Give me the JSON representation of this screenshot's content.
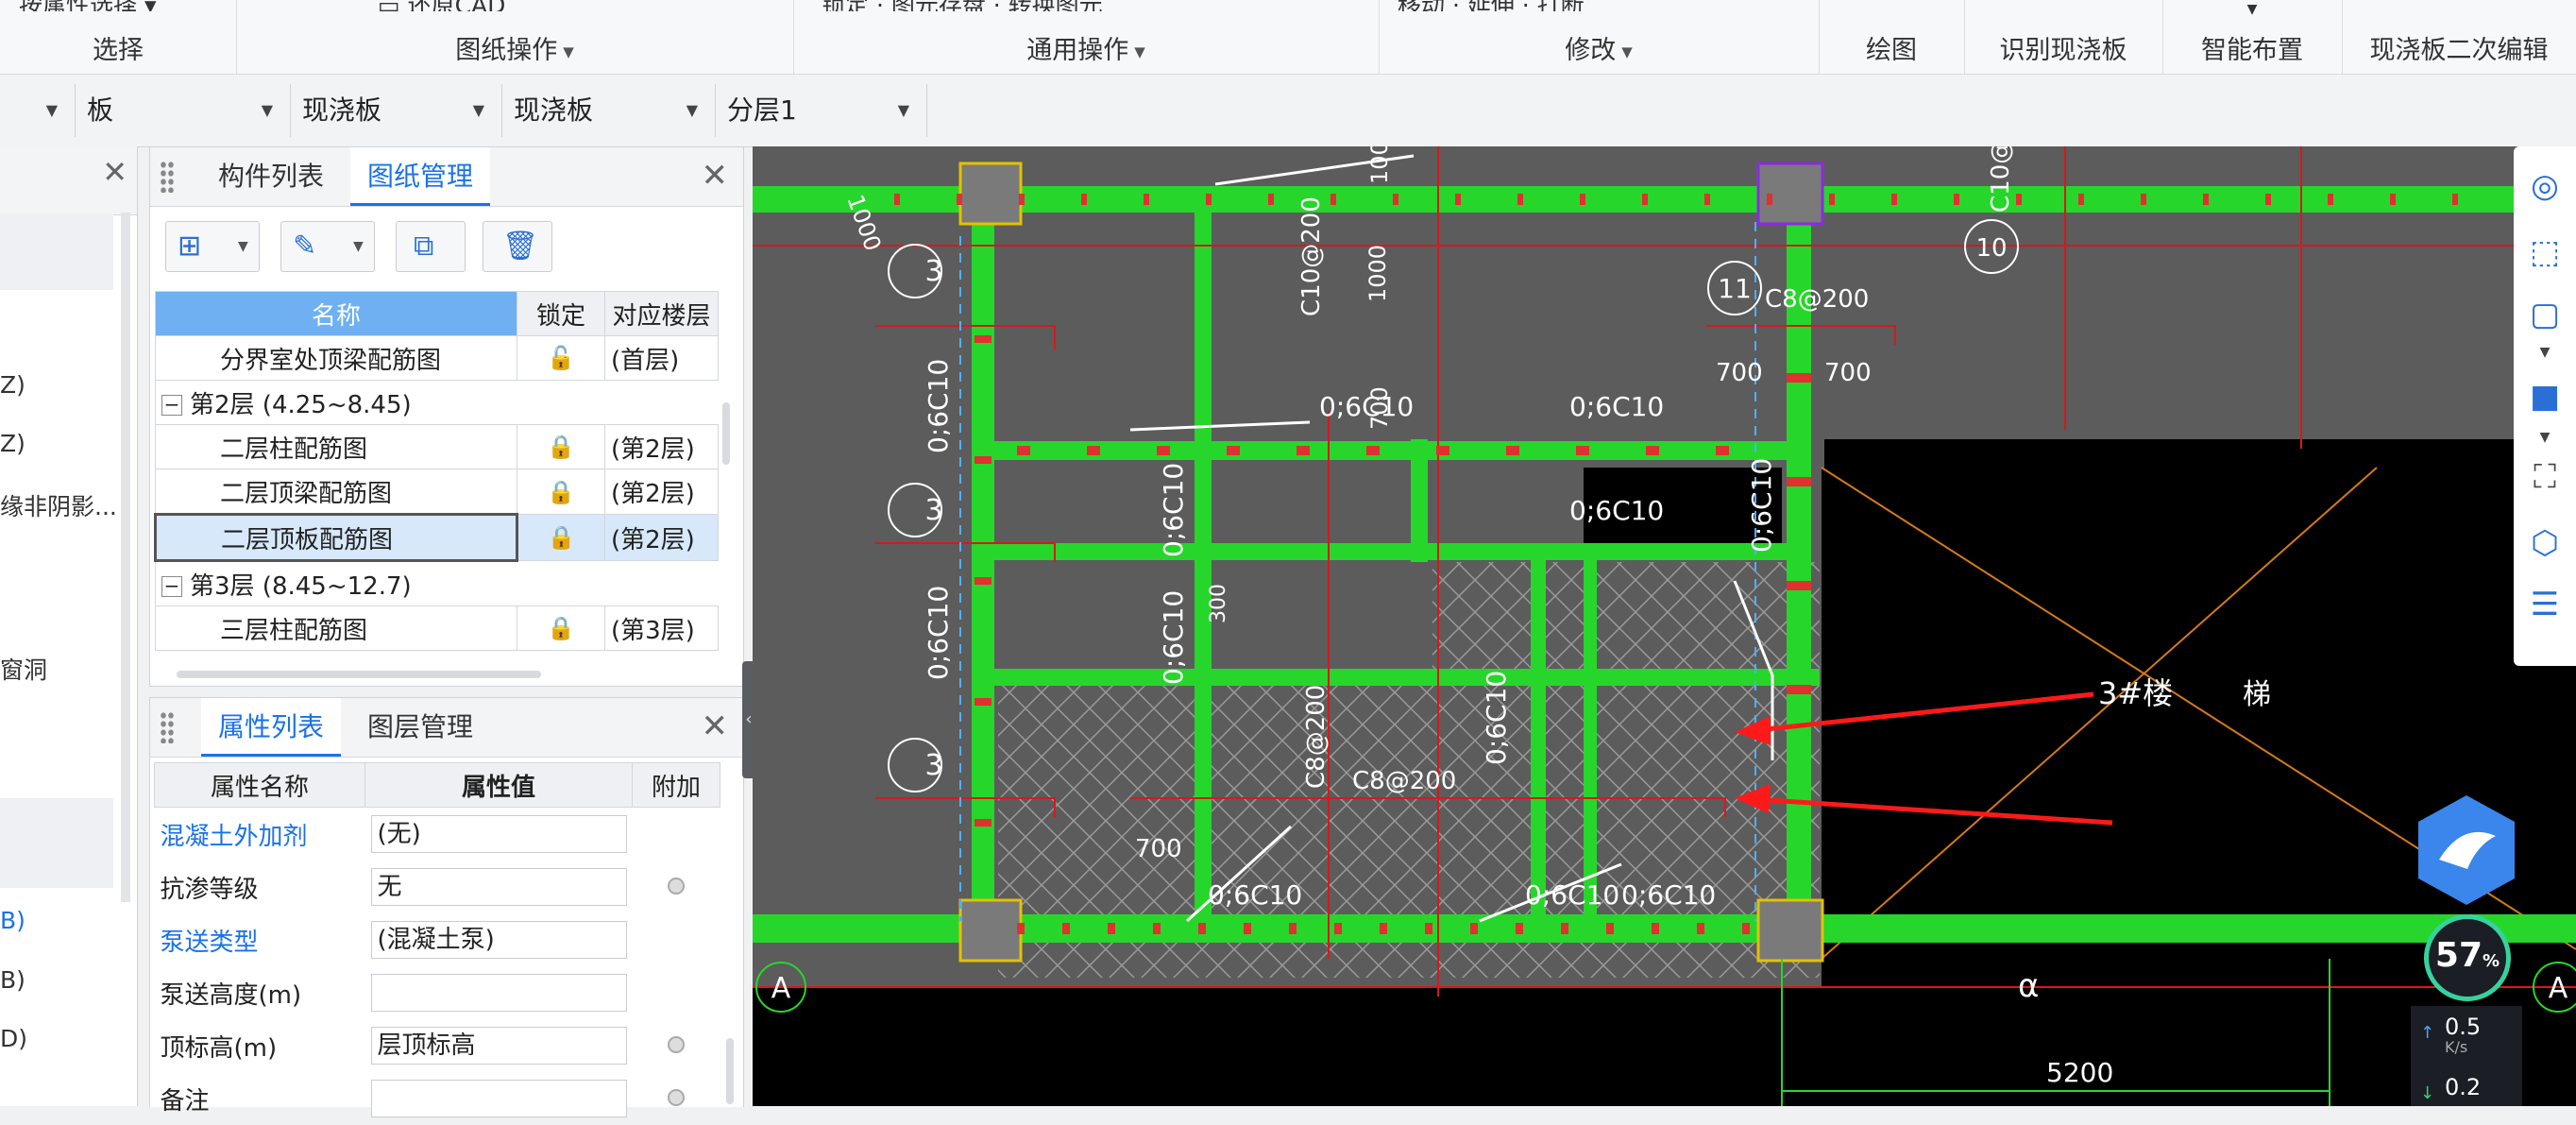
{
  "ribbon": {
    "groups": [
      {
        "top": "按属性选择",
        "label": "选择"
      },
      {
        "top": "还原CAD",
        "label": "图纸操作"
      },
      {
        "top": "锁定 · 图元存盘 · 转换图元",
        "label": "通用操作"
      },
      {
        "top": "移动 · 延伸 · 打断",
        "label": "修改"
      },
      {
        "top": "",
        "label": "绘图"
      },
      {
        "top": "",
        "label": "识别现浇板"
      },
      {
        "top": "",
        "label": "智能布置"
      },
      {
        "top": "",
        "label": "现浇板二次编辑"
      }
    ]
  },
  "selector": {
    "items": [
      "",
      "板",
      "现浇板",
      "现浇板",
      "分层1"
    ]
  },
  "left_panel": {
    "items": [
      "Z)",
      "Z)",
      "缘非阴影...",
      "窗洞",
      "B)",
      "B)",
      "D)"
    ]
  },
  "drawing_panel": {
    "tabs": [
      "构件列表",
      "图纸管理"
    ],
    "columns": [
      "名称",
      "锁定",
      "对应楼层"
    ],
    "rows": [
      {
        "name": "分界室处顶梁配筋图",
        "lock": "🔓",
        "floor": "(首层)",
        "group": false
      },
      {
        "name": "第2层 (4.25~8.45)",
        "lock": "",
        "floor": "",
        "group": true
      },
      {
        "name": "二层柱配筋图",
        "lock": "🔒",
        "floor": "(第2层)",
        "group": false
      },
      {
        "name": "二层顶梁配筋图",
        "lock": "🔒",
        "floor": "(第2层)",
        "group": false
      },
      {
        "name": "二层顶板配筋图",
        "lock": "🔒",
        "floor": "(第2层)",
        "group": false
      },
      {
        "name": "第3层 (8.45~12.7)",
        "lock": "",
        "floor": "",
        "group": true
      },
      {
        "name": "三层柱配筋图",
        "lock": "🔒",
        "floor": "(第3层)",
        "group": false
      }
    ]
  },
  "property_panel": {
    "tabs": [
      "属性列表",
      "图层管理"
    ],
    "columns": [
      "属性名称",
      "属性值",
      "附加"
    ],
    "rows": [
      {
        "name": "混凝土外加剂",
        "value": "(无)",
        "blue": true
      },
      {
        "name": "抗渗等级",
        "value": "无",
        "blue": false
      },
      {
        "name": "泵送类型",
        "value": "(混凝土泵)",
        "blue": true
      },
      {
        "name": "泵送高度(m)",
        "value": "",
        "blue": false
      },
      {
        "name": "顶标高(m)",
        "value": "层顶标高",
        "blue": false
      },
      {
        "name": "备注",
        "value": "",
        "blue": false
      }
    ]
  },
  "cad": {
    "labels": {
      "rebar1": "0;6C10",
      "rebar2": "0;6C10",
      "rebar3": "0;6C10",
      "rebar4": "0;6C10",
      "rebar5": "0;6C10",
      "rebar6": "0;6C10",
      "rebar7": "0;6C10",
      "rebar8": "0;6C10",
      "rebar9": "0;6C10",
      "rebar10": "0;6C10",
      "rebar11": "0;6C10",
      "rebar12": "0;6C10",
      "c1": "C8@200",
      "c2": "C8@200",
      "c3": "C10@200",
      "c4": "C8@200",
      "c5": "C10@200",
      "d1": "700",
      "d2": "700",
      "d3": "700",
      "d4": "700",
      "d5": "1000",
      "d6": "1000",
      "d7": "5200",
      "d8": "1000",
      "d9": "300",
      "axis3a": "3",
      "axis3b": "3",
      "axis3c": "3",
      "axis11": "11",
      "axis10": "10",
      "axisA1": "A",
      "axisA2": "A",
      "stair": "3#楼",
      "stair2": "梯",
      "alpha": "α"
    }
  },
  "perf": {
    "percent": "57",
    "unit": "%",
    "up": "0.5",
    "down": "0.2",
    "rate": "K/s"
  }
}
